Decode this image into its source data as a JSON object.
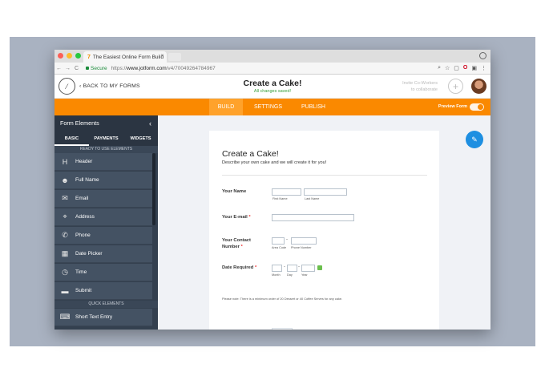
{
  "browser": {
    "tab_title": "The Easiest Online Form Build",
    "tab_close": "×",
    "secure_label": "Secure",
    "url_scheme": "https://",
    "url_host": "www.jotform.com",
    "url_path": "/v4/70049264784967",
    "nav": {
      "back": "←",
      "forward": "→",
      "reload": "C"
    },
    "icons": {
      "zoom": "⌕",
      "star": "☆",
      "ext1": "▢",
      "opera": "O",
      "ext2": "▣",
      "menu": "⋮"
    }
  },
  "header": {
    "logo_glyph": "⁄",
    "back_link": "BACK TO MY FORMS",
    "back_prefix": "‹",
    "form_title": "Create a Cake!",
    "save_status": "All changes saved!",
    "invite_line1": "Invite Co-Workers",
    "invite_line2": "to collaborate",
    "invite_plus": "+"
  },
  "topnav": {
    "tabs": [
      "BUILD",
      "SETTINGS",
      "PUBLISH"
    ],
    "active_tab": "BUILD",
    "preview_label": "Preview Form"
  },
  "sidebar": {
    "title": "Form Elements",
    "collapse_glyph": "‹",
    "tabs": [
      "BASIC",
      "PAYMENTS",
      "WIDGETS"
    ],
    "section_ready": "READY TO USE ELEMENTS",
    "items": [
      {
        "label": "Header",
        "icon": "header-icon",
        "glyph": "H"
      },
      {
        "label": "Full Name",
        "icon": "user-icon",
        "glyph": "☻"
      },
      {
        "label": "Email",
        "icon": "envelope-icon",
        "glyph": "✉"
      },
      {
        "label": "Address",
        "icon": "map-pin-icon",
        "glyph": "⌖"
      },
      {
        "label": "Phone",
        "icon": "phone-icon",
        "glyph": "✆"
      },
      {
        "label": "Date Picker",
        "icon": "calendar-icon",
        "glyph": "▦"
      },
      {
        "label": "Time",
        "icon": "clock-icon",
        "glyph": "◷"
      },
      {
        "label": "Submit",
        "icon": "submit-icon",
        "glyph": "▬"
      }
    ],
    "section_quick": "QUICK ELEMENTS",
    "quick_items": [
      {
        "label": "Short Text Entry",
        "icon": "text-entry-icon",
        "glyph": "⌨"
      }
    ]
  },
  "form": {
    "title": "Create a Cake!",
    "description": "Describe your own cake and we will create it for you!",
    "fields": {
      "name_label": "Your Name",
      "first_name": "First Name",
      "last_name": "Last Name",
      "email_label": "Your E-mail",
      "contact_label_1": "Your Contact",
      "contact_label_2": "Number",
      "area_code": "Area Code",
      "phone_number": "Phone Number",
      "date_label": "Date Required",
      "month": "Month",
      "day": "Day",
      "year": "Year",
      "required_mark": "*",
      "dash": "-"
    },
    "note": "Please note: There is a minimum order of 20 Dessert or 40 Coffee Serves for any cake."
  },
  "colors": {
    "orange": "#fa8900",
    "sidebar": "#34404f",
    "saved_green": "#37a03b",
    "fab_blue": "#1e8fe1"
  }
}
